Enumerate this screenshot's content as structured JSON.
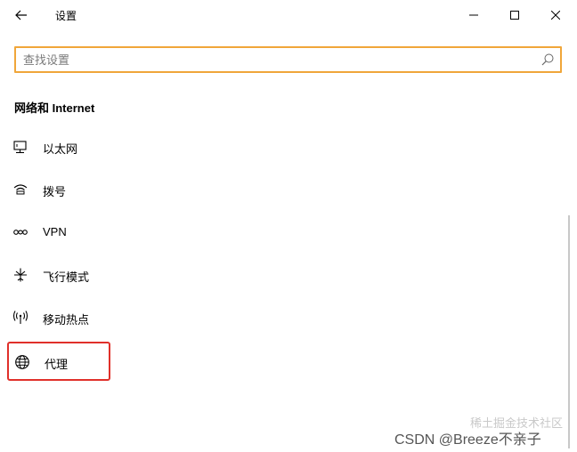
{
  "window": {
    "title": "设置",
    "minimize_label": "Minimize",
    "maximize_label": "Maximize",
    "close_label": "Close"
  },
  "search": {
    "placeholder": "查找设置",
    "value": ""
  },
  "section": {
    "heading": "网络和 Internet"
  },
  "nav": {
    "items": [
      {
        "label": "以太网",
        "icon": "ethernet-icon"
      },
      {
        "label": "拨号",
        "icon": "dialup-icon"
      },
      {
        "label": "VPN",
        "icon": "vpn-icon"
      },
      {
        "label": "飞行模式",
        "icon": "airplane-icon"
      },
      {
        "label": "移动热点",
        "icon": "hotspot-icon"
      },
      {
        "label": "代理",
        "icon": "globe-icon",
        "highlighted": true
      }
    ]
  },
  "watermark": {
    "text": "CSDN @Breeze不亲子",
    "faded_text": "稀土掘金技术社区"
  },
  "colors": {
    "search_border": "#f0a63a",
    "highlight_border": "#e0302a"
  }
}
